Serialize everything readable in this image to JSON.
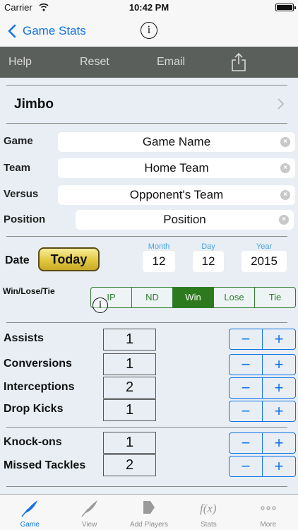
{
  "status_bar": {
    "carrier": "Carrier",
    "time": "10:42 PM"
  },
  "nav": {
    "back_label": "Game Stats",
    "info_glyph": "i"
  },
  "toolbar": {
    "help": "Help",
    "reset": "Reset",
    "email": "Email",
    "share_icon": "share-icon"
  },
  "player": {
    "name": "Jimbo"
  },
  "fields": {
    "game_label": "Game",
    "game_value": "Game Name",
    "team_label": "Team",
    "team_value": "Home Team",
    "versus_label": "Versus",
    "versus_value": "Opponent's Team",
    "position_label": "Position",
    "position_value": "Position"
  },
  "date": {
    "label": "Date",
    "today_button": "Today",
    "month_label": "Month",
    "month": "12",
    "day_label": "Day",
    "day": "12",
    "year_label": "Year",
    "year": "2015"
  },
  "result": {
    "label": "Win/Lose/Tie",
    "options": [
      "IP",
      "ND",
      "Win",
      "Lose",
      "Tie"
    ],
    "selected": "Win"
  },
  "stats": [
    {
      "label": "Assists",
      "value": "1"
    },
    {
      "label": "Conversions",
      "value": "1"
    },
    {
      "label": "Interceptions",
      "value": "2"
    },
    {
      "label": "Drop Kicks",
      "value": "1"
    },
    {
      "label": "Knock-ons",
      "value": "1"
    },
    {
      "label": "Missed Tackles",
      "value": "2"
    }
  ],
  "stepper": {
    "minus": "−",
    "plus": "+"
  },
  "tabs": [
    {
      "label": "Game",
      "icon": "feather-icon",
      "active": true
    },
    {
      "label": "View",
      "icon": "feather-icon",
      "active": false
    },
    {
      "label": "Add Players",
      "icon": "add-players-icon",
      "active": false
    },
    {
      "label": "Stats",
      "icon": "function-icon",
      "active": false
    },
    {
      "label": "More",
      "icon": "more-icon",
      "active": false
    }
  ],
  "colors": {
    "accent": "#1273e6",
    "toolbar": "#5b5f5c",
    "win_green": "#2d7a1e",
    "today_gold": "#e2c83f"
  }
}
